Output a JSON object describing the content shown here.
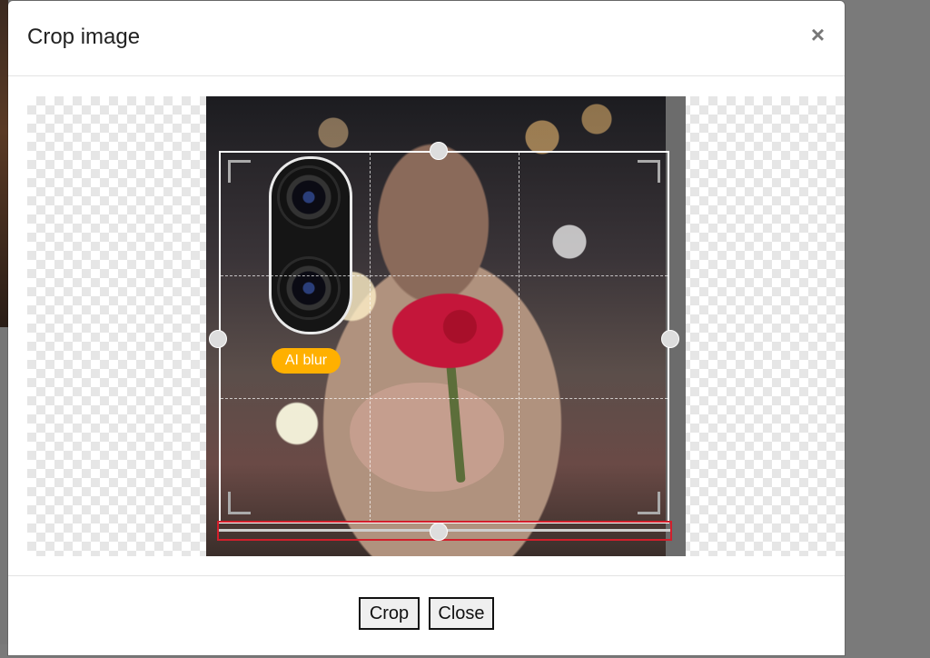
{
  "dialog": {
    "title": "Crop image",
    "close_symbol": "×"
  },
  "image": {
    "badge_text": "AI blur"
  },
  "footer": {
    "crop_label": "Crop",
    "close_label": "Close"
  },
  "icons": {
    "close": "close-icon"
  },
  "colors": {
    "badge": "#ffb000",
    "highlight_border": "#d21f2c"
  }
}
